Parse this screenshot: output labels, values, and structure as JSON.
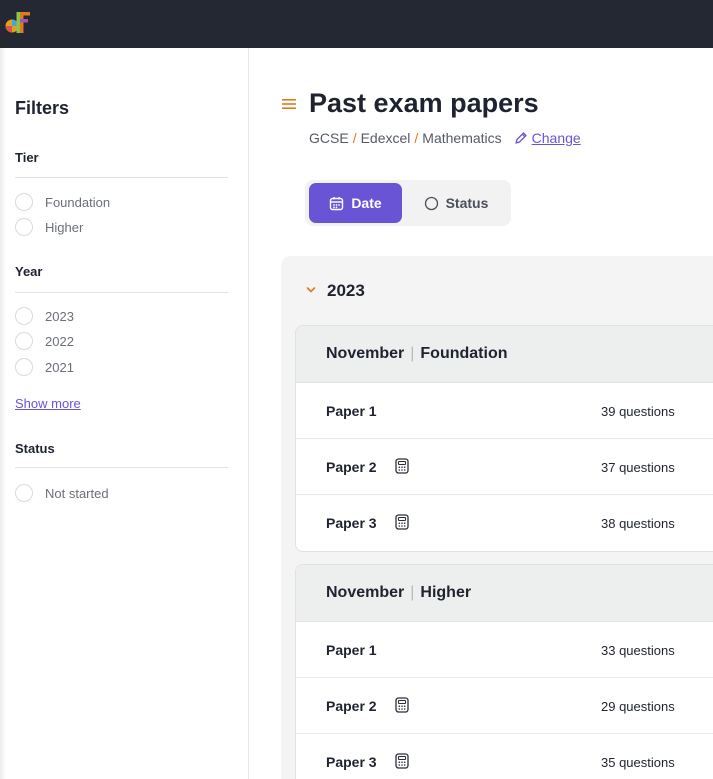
{
  "brand": {
    "logo_text": "df"
  },
  "sidebar": {
    "title": "Filters",
    "groups": [
      {
        "title": "Tier",
        "options": [
          "Foundation",
          "Higher"
        ]
      },
      {
        "title": "Year",
        "options": [
          "2023",
          "2022",
          "2021"
        ],
        "show_more": "Show more"
      },
      {
        "title": "Status",
        "options": [
          "Not started"
        ]
      }
    ]
  },
  "header": {
    "title": "Past exam papers",
    "breadcrumb": [
      "GCSE",
      "Edexcel",
      "Mathematics"
    ],
    "separator": "/",
    "change_label": "Change"
  },
  "view_toggle": {
    "date_label": "Date",
    "status_label": "Status",
    "selected": "Date"
  },
  "years": [
    {
      "year": "2023",
      "sessions": [
        {
          "month": "November",
          "tier": "Foundation",
          "papers": [
            {
              "name": "Paper 1",
              "calculator": false,
              "questions": "39 questions"
            },
            {
              "name": "Paper 2",
              "calculator": true,
              "questions": "37 questions"
            },
            {
              "name": "Paper 3",
              "calculator": true,
              "questions": "38 questions"
            }
          ]
        },
        {
          "month": "November",
          "tier": "Higher",
          "papers": [
            {
              "name": "Paper 1",
              "calculator": false,
              "questions": "33 questions"
            },
            {
              "name": "Paper 2",
              "calculator": true,
              "questions": "29 questions"
            },
            {
              "name": "Paper 3",
              "calculator": true,
              "questions": "35 questions"
            }
          ]
        }
      ]
    }
  ],
  "colors": {
    "accent": "#6a54d6",
    "orange": "#e07a1f",
    "topbar": "#232833"
  }
}
